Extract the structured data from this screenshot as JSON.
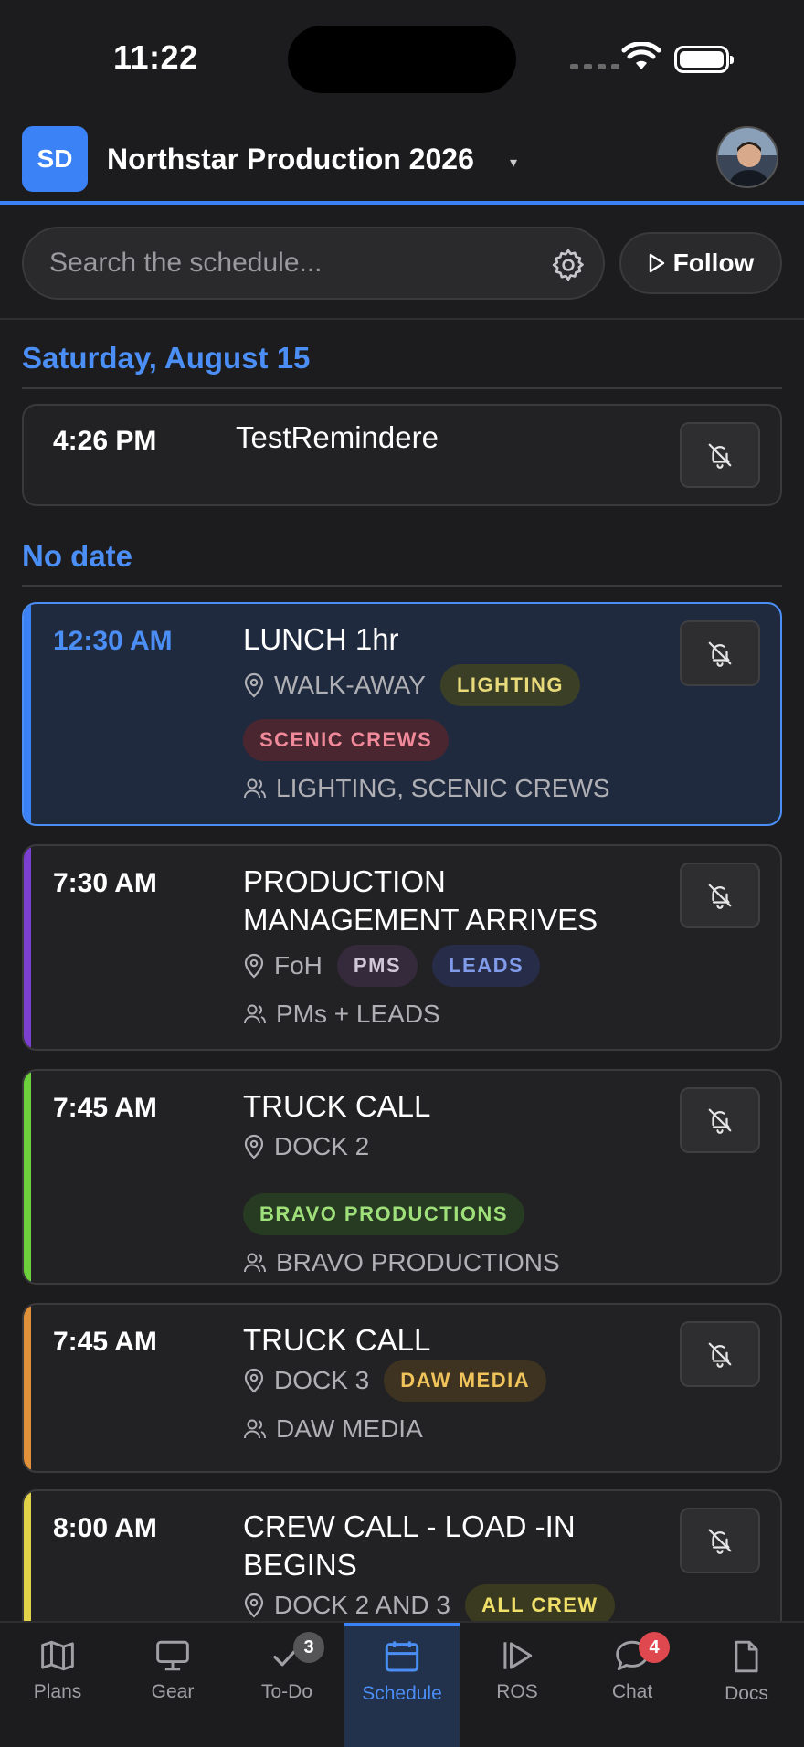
{
  "status_bar": {
    "time": "11:22"
  },
  "header": {
    "org_initials": "SD",
    "project_title": "Northstar Production 2026",
    "caret": "▾"
  },
  "search": {
    "placeholder": "Search the schedule...",
    "follow_label": "Follow"
  },
  "sections": [
    {
      "heading": "Saturday, August 15"
    },
    {
      "heading": "No date"
    }
  ],
  "events": [
    {
      "time": "4:26 PM",
      "title": "TestRemindere",
      "location": "",
      "tags": [],
      "crew": "",
      "stripe_color": ""
    },
    {
      "time": "12:30 AM",
      "title": "LUNCH 1hr",
      "location": "WALK-AWAY",
      "tags": [
        {
          "label": "LIGHTING",
          "bg": "#3a3f26",
          "fg": "#e8d97a"
        },
        {
          "label": "SCENIC CREWS",
          "bg": "#4a2630",
          "fg": "#f08a9a"
        }
      ],
      "crew": "LIGHTING, SCENIC CREWS",
      "stripe_color": "#3b82f6"
    },
    {
      "time": "7:30 AM",
      "title": "PRODUCTION MANAGEMENT ARRIVES",
      "location": "FoH",
      "tags": [
        {
          "label": "PMS",
          "bg": "#352a3c",
          "fg": "#d0c8d8"
        },
        {
          "label": "LEADS",
          "bg": "#272c48",
          "fg": "#7f9bea"
        }
      ],
      "crew": "PMs + LEADS",
      "stripe_color": "#7b3fd1"
    },
    {
      "time": "7:45 AM",
      "title": "TRUCK CALL",
      "location": "DOCK 2",
      "tags": [
        {
          "label": "BRAVO PRODUCTIONS",
          "bg": "#273a22",
          "fg": "#9fe07a"
        }
      ],
      "crew": "BRAVO PRODUCTIONS",
      "stripe_color": "#6cd13a"
    },
    {
      "time": "7:45 AM",
      "title": "TRUCK CALL",
      "location": "DOCK 3",
      "tags": [
        {
          "label": "DAW MEDIA",
          "bg": "#3d3320",
          "fg": "#f0c45a"
        }
      ],
      "crew": "DAW MEDIA",
      "stripe_color": "#e0913a"
    },
    {
      "time": "8:00 AM",
      "title": "CREW CALL - LOAD -IN BEGINS",
      "location": "DOCK 2 AND 3",
      "tags": [
        {
          "label": "ALL CREW",
          "bg": "#3a3a20",
          "fg": "#f0e06a"
        }
      ],
      "crew": "",
      "stripe_color": "#e2d24a"
    }
  ],
  "tabs": [
    {
      "label": "Plans",
      "icon": "map-icon",
      "badge": ""
    },
    {
      "label": "Gear",
      "icon": "monitor-icon",
      "badge": ""
    },
    {
      "label": "To-Do",
      "icon": "check-icon",
      "badge": "3",
      "badge_color": "#555558"
    },
    {
      "label": "Schedule",
      "icon": "calendar-icon",
      "badge": "",
      "selected": true
    },
    {
      "label": "ROS",
      "icon": "play-skip-icon",
      "badge": ""
    },
    {
      "label": "Chat",
      "icon": "chat-bubble-icon",
      "badge": "4",
      "badge_color": "#e0484f"
    },
    {
      "label": "Docs",
      "icon": "document-icon",
      "badge": ""
    }
  ]
}
